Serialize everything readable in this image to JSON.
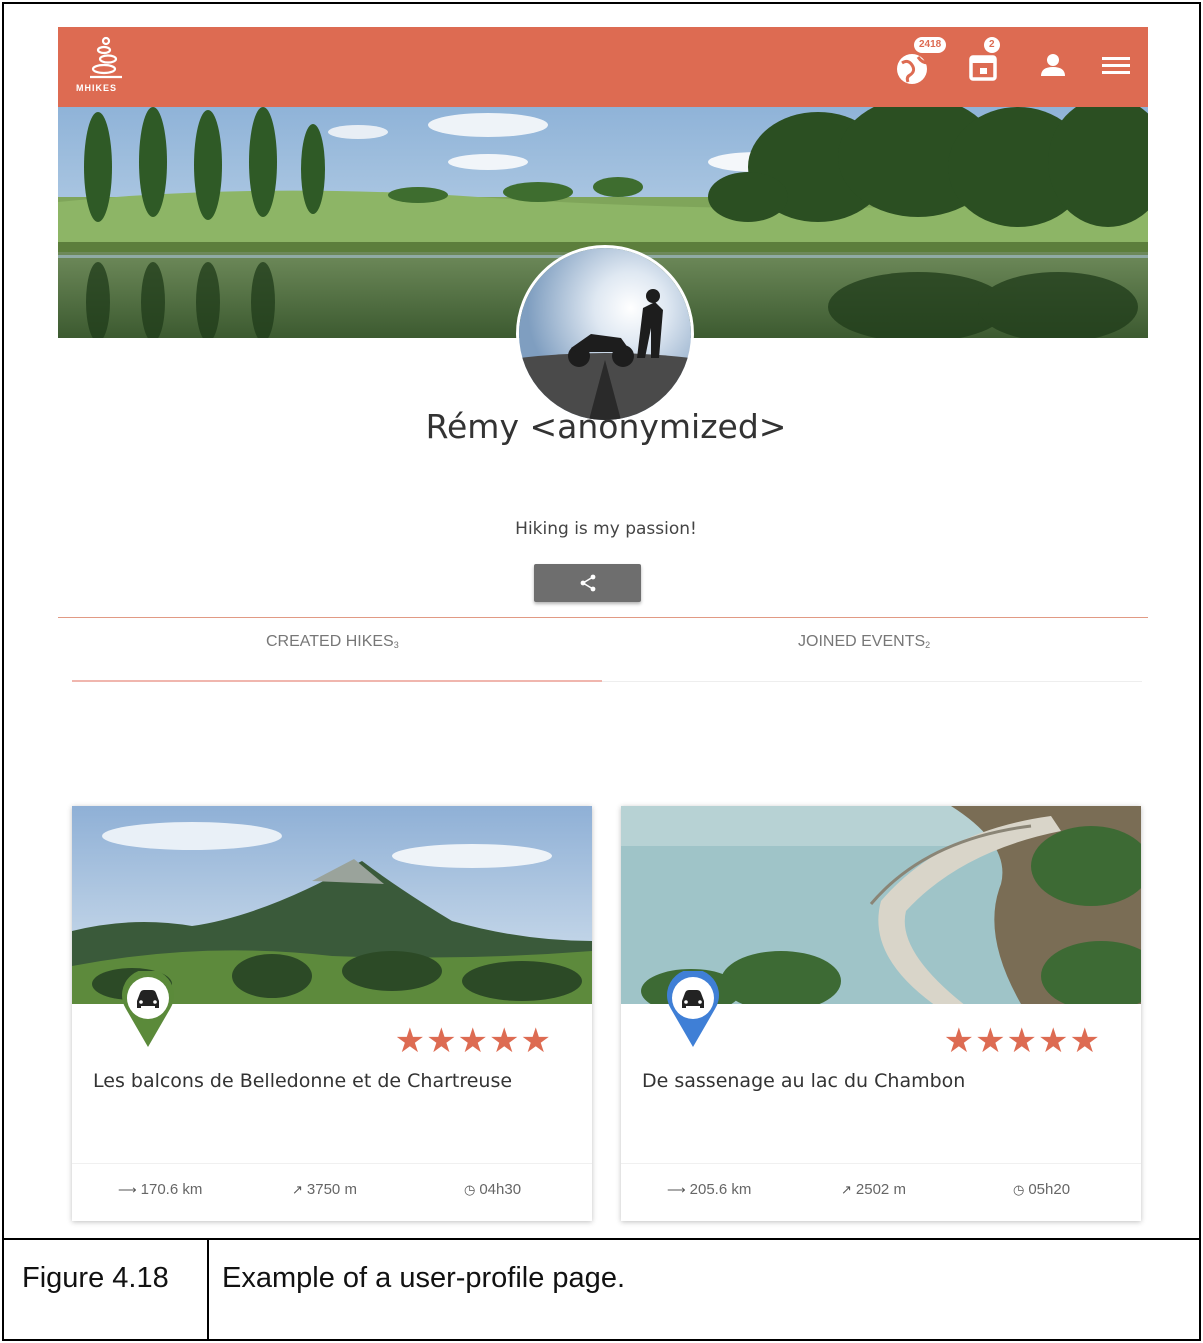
{
  "app": {
    "logo_text": "MHIKES",
    "brand_color": "#dd6b52",
    "nav": {
      "world_badge": "2418",
      "calendar_badge": "2",
      "user_icon": "user-icon",
      "menu_icon": "hamburger-menu-icon"
    }
  },
  "profile": {
    "name": "Rémy <anonymized>",
    "bio": "Hiking is my passion!",
    "share_icon": "share-icon"
  },
  "tabs": [
    {
      "label": "CREATED HIKES",
      "count": "3",
      "active": true
    },
    {
      "label": "JOINED EVENTS",
      "count": "2",
      "active": false
    }
  ],
  "hikes": [
    {
      "title": "Les balcons de Belledonne et de Chartreuse",
      "rating": 5,
      "stars": "★★★★★",
      "pin_color": "#5b8a3a",
      "pin_icon": "car-icon",
      "distance": "170.6 km",
      "elevation": "3750 m",
      "duration": "04h30"
    },
    {
      "title": "De sassenage au lac du Chambon",
      "rating": 5,
      "stars": "★★★★★",
      "pin_color": "#3f7fd6",
      "pin_icon": "car-icon",
      "distance": "205.6 km",
      "elevation": "2502 m",
      "duration": "05h20"
    }
  ],
  "caption": {
    "label": "Figure 4.18",
    "text": "Example of a user-profile page."
  }
}
